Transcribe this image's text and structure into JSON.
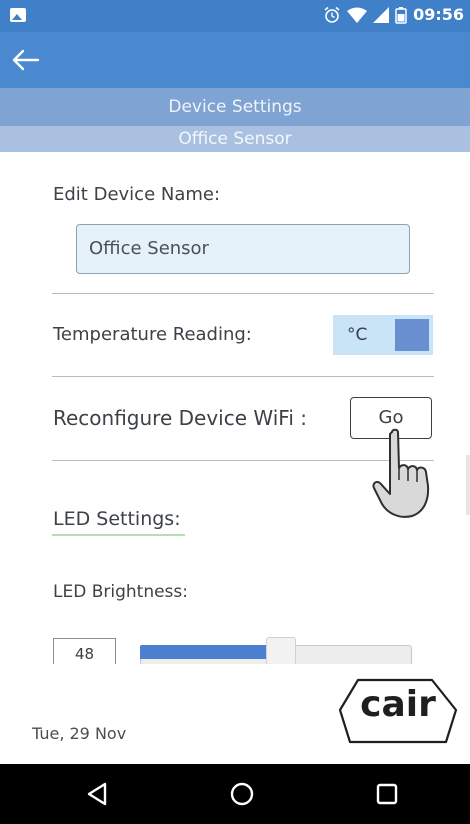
{
  "status_bar": {
    "time": "09:56",
    "icons": [
      "image-icon",
      "alarm-icon",
      "wifi-icon",
      "signal-icon",
      "battery-icon"
    ]
  },
  "app_bar": {
    "back_icon": "back-arrow-icon"
  },
  "header": {
    "title": "Device Settings",
    "subtitle": "Office Sensor"
  },
  "device_name": {
    "label": "Edit Device Name:",
    "value": "Office Sensor"
  },
  "temperature": {
    "label": "Temperature Reading:",
    "unit": "°C"
  },
  "wifi": {
    "label": "Reconfigure Device WiFi :",
    "button_label": "Go"
  },
  "led": {
    "section_label": "LED Settings:",
    "brightness_label": "LED Brightness:",
    "brightness_value": "48",
    "brightness_fraction": 0.48
  },
  "footer": {
    "date": "Tue, 29 Nov",
    "logo_text": "cair"
  },
  "nav_bar": {
    "icons": [
      "back-triangle-icon",
      "home-circle-icon",
      "recents-square-icon"
    ]
  },
  "colors": {
    "status_bar": "#3f80c8",
    "app_bar": "#4a89cf",
    "title_band": "#7fa3d2",
    "subtitle_band": "#a9c0e0",
    "accent": "#4c7fd0",
    "input_bg": "#e5f2fa",
    "toggle_bg": "#c9e4f6",
    "led_underline": "#b8dfb4"
  }
}
